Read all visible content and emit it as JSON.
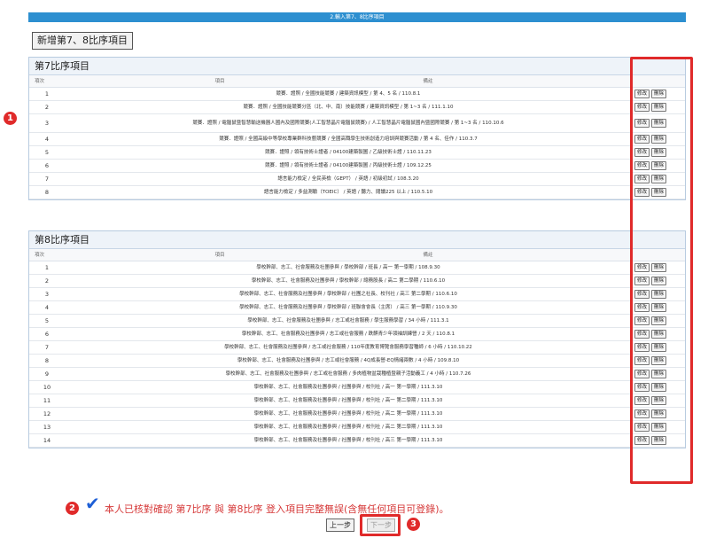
{
  "header": {
    "title": "2.輸入第7、8比序項目"
  },
  "toolbar": {
    "add_label": "新增第7、8比序項目"
  },
  "section7": {
    "title": "第7比序項目",
    "columns": {
      "no": "項次",
      "item": "項目",
      "note": "備註"
    },
    "rows": [
      {
        "no": "1",
        "text": "競賽．證照 / 全國技能競賽 / 建築資訊模型 / 第 4、5 名 / 110.8.1"
      },
      {
        "no": "2",
        "text": "競賽．證照 / 全國技能競賽分區（北、中、南）技能競賽 / 建築資訊模型 / 第 1~3 名 / 111.1.10"
      },
      {
        "no": "3",
        "text": "競賽．證照 / 電腦鼠暨智慧輸送機器人國內及國際競賽(人工智慧晶片電腦鼠競賽) / 人工智慧晶片電腦鼠國內暨國際競賽 / 第 1~3 名 / 110.10.6"
      },
      {
        "no": "4",
        "text": "競賽．證照 / 全國高級中等學校專業群科技藝競賽 / 全國高職學生技術創造力培訓與競賽活動 / 第 4 名、佳作 / 110.3.7"
      },
      {
        "no": "5",
        "text": "競賽．證照 / 領有技術士證者 / 04100建築製圖 / 乙級技術士證 / 110.11.23"
      },
      {
        "no": "6",
        "text": "競賽．證照 / 領有技術士證者 / 04100建築製圖 / 丙級技術士證 / 109.12.25"
      },
      {
        "no": "7",
        "text": "語言能力檢定 / 全民英檢（GEPT） / 英語 / 初級初試 / 108.3.20"
      },
      {
        "no": "8",
        "text": "語言能力檢定 / 多益測驗（TOEIC） / 英語 / 聽力、閱讀225 以上 / 110.5.10"
      }
    ]
  },
  "section8": {
    "title": "第8比序項目",
    "columns": {
      "no": "項次",
      "item": "項目",
      "note": "備註"
    },
    "rows": [
      {
        "no": "1",
        "text": "學校幹部、志工、社會服務及社團參與 / 學校幹部 / 班長 / 高一 第一學期 / 108.9.30"
      },
      {
        "no": "2",
        "text": "學校幹部、志工、社會服務及社團參與 / 學校幹部 / 總務股長 / 高二 第二學期 / 110.6.10"
      },
      {
        "no": "3",
        "text": "學校幹部、志工、社會服務及社團參與 / 學校幹部 / 社團之社長、校刊社 / 高三 第二學期 / 110.6.10"
      },
      {
        "no": "4",
        "text": "學校幹部、志工、社會服務及社團參與 / 學校幹部 / 班聯會會長（主席） / 高三 第一學期 / 110.9.30"
      },
      {
        "no": "5",
        "text": "學校幹部、志工、社會服務及社團參與 / 志工或社會服務 / 學生服務學習 / 34 小時 / 111.3.1"
      },
      {
        "no": "6",
        "text": "學校幹部、志工、社會服務及社團參與 / 志工或社會服務 / 跌麒青少年領袖訓練營 / 2 天 / 110.8.1"
      },
      {
        "no": "7",
        "text": "學校幹部、志工、社會服務及社團參與 / 志工或社會服務 / 110年度教育博覽會服務學習種師 / 6 小時 / 110.10.22"
      },
      {
        "no": "8",
        "text": "學校幹部、志工、社會服務及社團參與 / 志工或社會服務 / 4Q成長營-EQ情緒兩數 / 4 小時 / 109.8.10"
      },
      {
        "no": "9",
        "text": "學校幹部、志工、社會服務及社團參與 / 志工或社會服務 / 多肉植物盆栽種植暨親子活動義工 / 4 小時 / 110.7.26"
      },
      {
        "no": "10",
        "text": "學校幹部、志工、社會服務及社團參與 / 社團參與 / 校刊社 / 高一 第一學期 / 111.3.10"
      },
      {
        "no": "11",
        "text": "學校幹部、志工、社會服務及社團參與 / 社團參與 / 校刊社 / 高一 第二學期 / 111.3.10"
      },
      {
        "no": "12",
        "text": "學校幹部、志工、社會服務及社團參與 / 社團參與 / 校刊社 / 高二 第一學期 / 111.3.10"
      },
      {
        "no": "13",
        "text": "學校幹部、志工、社會服務及社團參與 / 社團參與 / 校刊社 / 高二 第二學期 / 111.3.10"
      },
      {
        "no": "14",
        "text": "學校幹部、志工、社會服務及社團參與 / 社團參與 / 校刊社 / 高三 第一學期 / 111.3.10"
      }
    ]
  },
  "row_actions": {
    "edit": "修改",
    "delete": "刪除"
  },
  "annotations": {
    "badge1": "1",
    "badge2": "2",
    "badge3": "3"
  },
  "confirm": {
    "text": "本人已核對確認 第7比序 與 第8比序 登入項目完整無誤(含無任何項目可登錄)。"
  },
  "nav": {
    "prev": "上一步",
    "next": "下一步"
  },
  "colors": {
    "header": "#2d8fd0",
    "highlight": "#e02a2a",
    "check": "#1e5fd6"
  }
}
